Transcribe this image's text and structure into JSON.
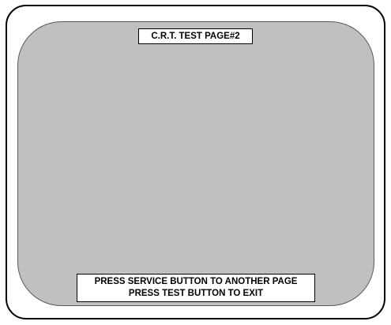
{
  "page": {
    "title": "C.R.T. TEST PAGE#2"
  },
  "messages": {
    "line1": "PRESS SERVICE BUTTON TO ANOTHER PAGE",
    "line2": "PRESS TEST BUTTON TO EXIT"
  },
  "colors": {
    "screen": "#c0c0c0",
    "frame": "#000000",
    "label_background": "#ffffff"
  }
}
